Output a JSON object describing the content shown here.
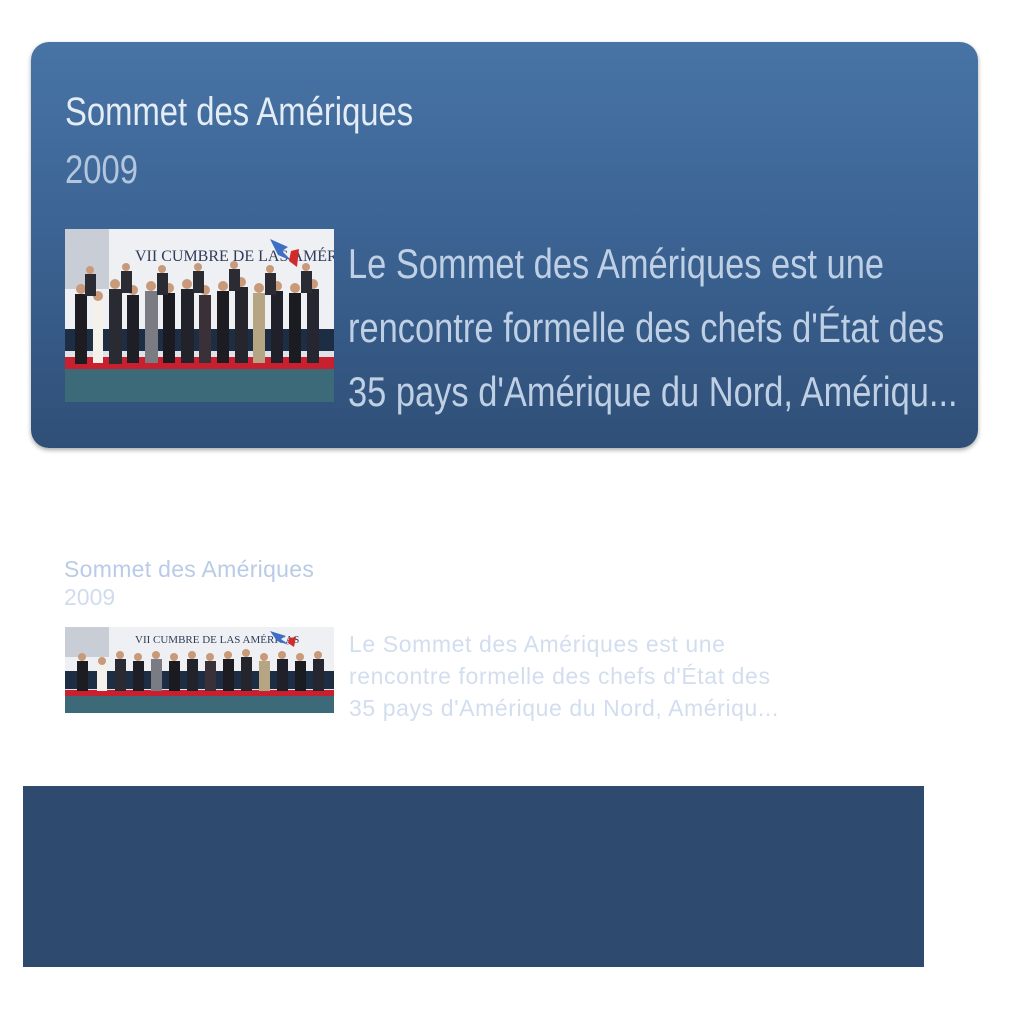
{
  "card": {
    "title": "Sommet des Amériques",
    "year": "2009",
    "description_lines": [
      "Le Sommet des Amériques est une",
      "rencontre formelle des chefs d'État des",
      "35 pays d'Amérique du Nord, Amériqu..."
    ],
    "thumbnail": {
      "banner_text": "VII CUMBRE DE LAS AMÉRICAS"
    }
  },
  "ghost": {
    "title": "Sommet des Amériques",
    "year": "2009",
    "description_lines": [
      "Le Sommet des Amériques est une",
      "rencontre formelle des chefs d'État des",
      "35 pays d'Amérique du Nord, Amériqu..."
    ],
    "thumbnail": {
      "banner_text": "VII CUMBRE DE LAS AMÉRICAS"
    }
  },
  "colors": {
    "card_top": "#4774a5",
    "card_bottom": "#2f4f77",
    "panel": "#2e4b6f"
  }
}
